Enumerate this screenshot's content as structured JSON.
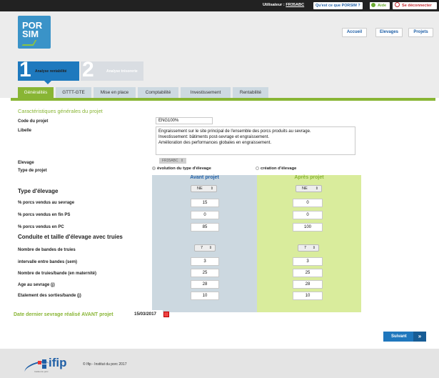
{
  "topbar": {
    "user_label": "Utilisateur :",
    "user_name": "FR35ABC",
    "what_label": "Qu'est ce que PORSIM ?",
    "help_label": "Aide",
    "logout_label": "Se déconnecter"
  },
  "header": {
    "logo_line1": "POR",
    "logo_line2": "SIM",
    "nav": [
      "Accueil",
      "Elevages",
      "Projets"
    ]
  },
  "steps": [
    {
      "num": "1",
      "label": "Analyse rentabilité"
    },
    {
      "num": "2",
      "label": "Analyse trésorerie"
    }
  ],
  "tabs": [
    "Généralités",
    "GTTT-GTE",
    "Mise en place",
    "Comptabilité",
    "Investissement",
    "Rentabilité"
  ],
  "main": {
    "section_title": "Caractéristiques générales du projet",
    "code_label": "Code du projet",
    "code_value": "ENG100%",
    "libelle_label": "Libelle",
    "libelle_lines": [
      "Engraissement sur le site principal de l'ensemble des porcs produits au sevrage.",
      "Investissement: bâtiments post-sevrage et engraissement.",
      "Amélioration des performances globales en engraissement."
    ],
    "elevage_label": "Elevage",
    "elevage_value": "FR35ABC",
    "type_projet_label": "Type de projet",
    "type_option_1": "évolution du type d'élevage",
    "type_option_2": "création d'élevage",
    "col_before": "Avant projet",
    "col_after": "Après projet",
    "type_elevage_label": "Type d'élevage",
    "type_elevage_before": "NE",
    "type_elevage_after": "NE",
    "rows1": [
      {
        "label": "% porcs vendus au sevrage",
        "before": "15",
        "after": "0"
      },
      {
        "label": "% porcs vendus en fin PS",
        "before": "0",
        "after": "0"
      },
      {
        "label": "% porcs vendus en PC",
        "before": "85",
        "after": "100"
      }
    ],
    "conduite_label": "Conduite et taille d'élevage avec truies",
    "bandes_label": "Nombre de bandes de truies",
    "bandes_before": "7",
    "bandes_after": "7",
    "rows2": [
      {
        "label": "intervalle entre bandes (sem)",
        "before": "3",
        "after": "3"
      },
      {
        "label": "Nombre de truies/bande (en maternité)",
        "before": "25",
        "after": "25"
      },
      {
        "label": "Age au sevrage (j)",
        "before": "28",
        "after": "28"
      },
      {
        "label": "Etalement des sorties/bande (j)",
        "before": "10",
        "after": "10"
      }
    ],
    "date_label": "Date dernier sevrage réalisé AVANT projet",
    "date_value": "15/03/2017",
    "next_label": "Suivant"
  },
  "footer": {
    "logo_word": "ifip",
    "logo_small": "Institut du porc",
    "copyright": "© Ifip - Institut du porc 2017"
  },
  "colors": {
    "green": "#88b534",
    "blue": "#1f77bd",
    "before_bg": "#ccd8e0",
    "after_bg": "#d9ec9c"
  }
}
